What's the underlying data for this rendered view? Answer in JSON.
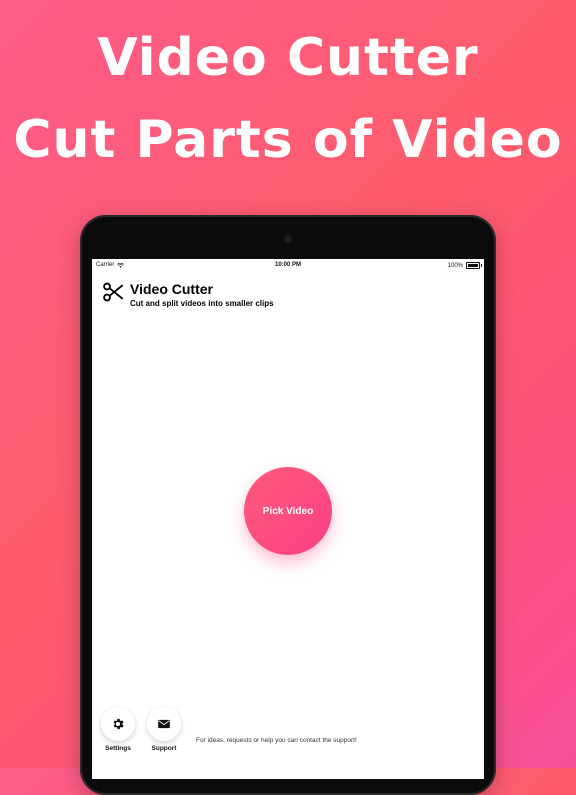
{
  "headline": {
    "line1": "Video Cutter",
    "line2": "Cut Parts of Video"
  },
  "status_bar": {
    "carrier": "Carrier",
    "time": "10:00 PM",
    "battery": "100%"
  },
  "app": {
    "title": "Video Cutter",
    "subtitle": "Cut and split videos into smaller clips",
    "icon": "scissors-icon"
  },
  "main": {
    "pick_video_label": "Pick Video"
  },
  "bottom": {
    "settings_label": "Settings",
    "support_label": "Support",
    "note": "For ideas, requests or help you can contact the support!"
  },
  "colors": {
    "background_start": "#fd5b8a",
    "background_end": "#fe5c6c",
    "accent": "#fb3f86"
  }
}
